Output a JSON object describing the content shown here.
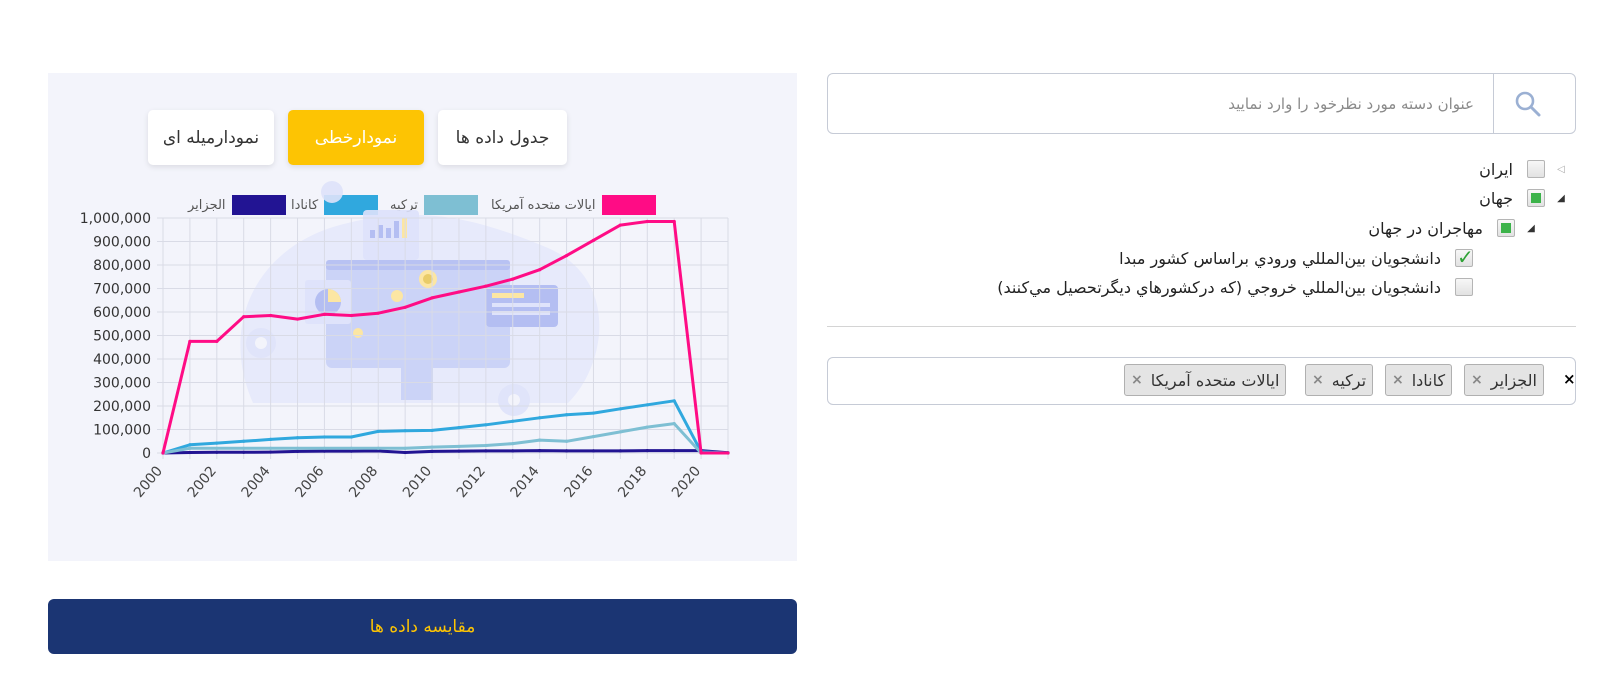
{
  "tabs": {
    "bar_chart": "نمودارمیله ای",
    "line_chart": "نمودارخطی",
    "data_table": "جدول داده ها"
  },
  "compare_button": "مقایسه داده ها",
  "search": {
    "placeholder": "عنوان دسته مورد نظرخود را وارد نمایید"
  },
  "tree": [
    {
      "label": "ایران",
      "state": "unchecked",
      "expanded": false
    },
    {
      "label": "جهان",
      "state": "partial",
      "expanded": true
    },
    {
      "label": "مهاجران در جهان",
      "state": "partial",
      "expanded": true
    },
    {
      "label": "دانشجويان بين‌المللي ورودي براساس كشور مبدا",
      "state": "checked"
    },
    {
      "label": "دانشجويان بين‌المللي خروجي (كه دركشورهاي ديگرتحصيل مي‌كنند)",
      "state": "unchecked"
    }
  ],
  "selected_tags": [
    "الجزایر",
    "کانادا",
    "ترکیه",
    "ایالات متحده آمریکا"
  ],
  "clear_all": "×",
  "tag_remove": "×",
  "chart_data": {
    "type": "line",
    "x": [
      2000,
      2001,
      2002,
      2003,
      2004,
      2005,
      2006,
      2007,
      2008,
      2009,
      2010,
      2011,
      2012,
      2013,
      2014,
      2015,
      2016,
      2017,
      2018,
      2019,
      2020,
      2021
    ],
    "x_ticks": [
      "2000",
      "2002",
      "2004",
      "2006",
      "2008",
      "2010",
      "2012",
      "2014",
      "2016",
      "2018",
      "2020"
    ],
    "y_ticks": [
      "0",
      "100,000",
      "200,000",
      "300,000",
      "400,000",
      "500,000",
      "600,000",
      "700,000",
      "800,000",
      "900,000",
      "1,000,000"
    ],
    "ylim": [
      0,
      1000000
    ],
    "grid": true,
    "legend_position": "top",
    "series": [
      {
        "name": "ایالات متحده آمریکا",
        "color": "#ff0c85",
        "values": [
          0,
          475000,
          475000,
          580000,
          585000,
          570000,
          590000,
          585000,
          595000,
          620000,
          660000,
          685000,
          710000,
          740000,
          780000,
          840000,
          905000,
          970000,
          985000,
          985000,
          0,
          0
        ]
      },
      {
        "name": "ترکیه",
        "color": "#7ebfd3",
        "values": [
          0,
          20000,
          20000,
          20000,
          20000,
          20000,
          20000,
          20000,
          20000,
          20000,
          25000,
          28000,
          32000,
          40000,
          55000,
          50000,
          70000,
          90000,
          110000,
          125000,
          0,
          0
        ]
      },
      {
        "name": "کانادا",
        "color": "#30a8de",
        "values": [
          0,
          35000,
          42000,
          50000,
          58000,
          65000,
          68000,
          68000,
          92000,
          95000,
          96000,
          108000,
          120000,
          135000,
          150000,
          163000,
          170000,
          188000,
          205000,
          222000,
          5000,
          0
        ]
      },
      {
        "name": "الجزایر",
        "color": "#221493",
        "values": [
          0,
          2000,
          3000,
          3000,
          4000,
          7000,
          8000,
          8000,
          9000,
          2000,
          7000,
          8000,
          9000,
          9000,
          10000,
          9000,
          9000,
          9000,
          10000,
          10000,
          10000,
          1000
        ]
      }
    ]
  }
}
